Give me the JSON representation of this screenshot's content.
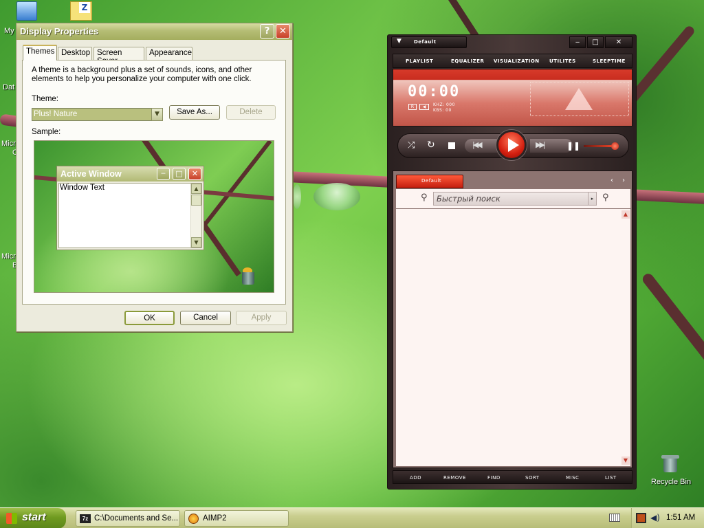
{
  "desktop": {
    "icons": [
      {
        "name": "my-computer",
        "label": "My"
      },
      {
        "name": "data",
        "label": "Dat"
      },
      {
        "name": "microsoft-1",
        "label": "Micro",
        "label2": "O"
      },
      {
        "name": "microsoft-2",
        "label": "Micro",
        "label2": "B"
      },
      {
        "name": "recycle-bin",
        "label": "Recycle Bin"
      }
    ]
  },
  "display_properties": {
    "title": "Display Properties",
    "help_btn": "?",
    "close_btn": "✕",
    "tabs": [
      "Themes",
      "Desktop",
      "Screen Saver",
      "Appearance"
    ],
    "description": "A theme is a background plus a set of sounds, icons, and other elements to help you personalize your computer with one click.",
    "theme_label": "Theme:",
    "theme_value": "Plus! Nature",
    "save_as": "Save As...",
    "delete": "Delete",
    "sample_label": "Sample:",
    "sample_window": {
      "title": "Active Window",
      "body": "Window Text"
    },
    "ok": "OK",
    "cancel": "Cancel",
    "apply": "Apply"
  },
  "aimp": {
    "skin_name": "Default",
    "window_btns": [
      "‒",
      "□",
      "✕"
    ],
    "menu": [
      "PLAYLIST",
      "EQUALIZER",
      "VISUALIZATION",
      "UTILITES",
      "SLEEPTIME"
    ],
    "time": "00:00",
    "khz": "KHZ: 000",
    "kbs": "KBS: 00",
    "playlist_tab": "Default",
    "search_placeholder": "Быстрый поиск",
    "bottom": [
      "ADD",
      "REMOVE",
      "FIND",
      "SORT",
      "MISC",
      "LIST"
    ]
  },
  "taskbar": {
    "start": "start",
    "tasks": [
      {
        "label": "C:\\Documents and Se...",
        "icon": "7z-icon"
      },
      {
        "label": "AIMP2",
        "icon": "aimp-icon"
      }
    ],
    "clock": "1:51 AM"
  }
}
